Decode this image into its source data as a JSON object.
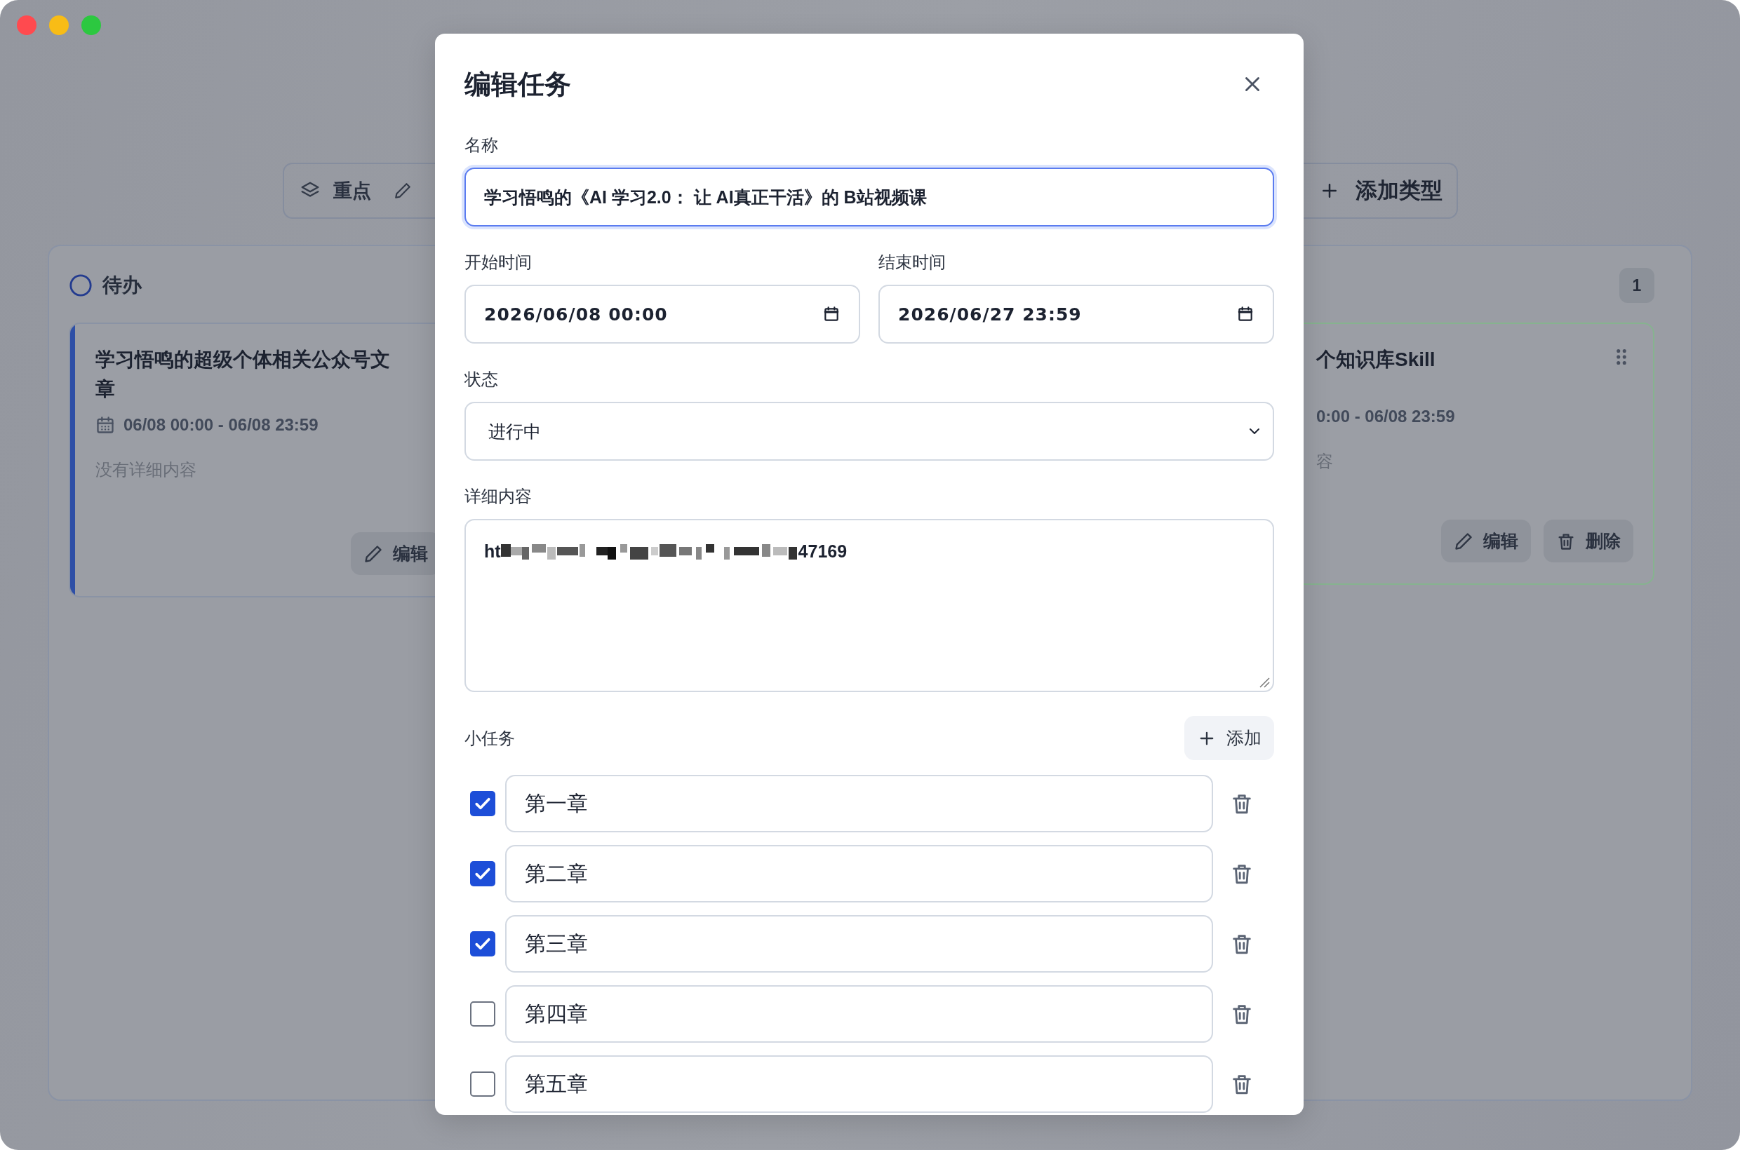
{
  "toolbar": {
    "type_chip": {
      "label": "重点"
    },
    "add_type_button": "添加类型"
  },
  "column": {
    "title": "待办",
    "count": "1",
    "cards": [
      {
        "title": "学习悟鸣的超级个体相关公众号文章",
        "date": "06/08 00:00 - 06/08 23:59",
        "description": "没有详细内容",
        "handle": false,
        "color": "#2e4fa6",
        "buttons": [
          {
            "kind": "edit",
            "label": "编辑"
          }
        ]
      },
      {
        "title": "个知识库Skill",
        "date": "0:00 - 06/08 23:59",
        "description": "容",
        "handle": true,
        "color": "#86b38f",
        "buttons": [
          {
            "kind": "edit",
            "label": "编辑"
          },
          {
            "kind": "delete",
            "label": "删除"
          }
        ]
      }
    ]
  },
  "dialog": {
    "title": "编辑任务",
    "name": {
      "label": "名称",
      "value": "学习悟鸣的《AI 学习2.0： 让 AI真正干活》的 B站视频课",
      "focused": true
    },
    "start": {
      "label": "开始时间",
      "value": "2026/06/08 00:00"
    },
    "end": {
      "label": "结束时间",
      "value": "2026/06/27 23:59"
    },
    "status": {
      "label": "状态",
      "value": "进行中"
    },
    "details": {
      "label": "详细内容",
      "text_start": "ht",
      "text_end": "47169"
    },
    "subtasks": {
      "label": "小任务",
      "add_button": "添加",
      "items": [
        {
          "title": "第一章",
          "checked": true
        },
        {
          "title": "第二章",
          "checked": true
        },
        {
          "title": "第三章",
          "checked": true
        },
        {
          "title": "第四章",
          "checked": false
        },
        {
          "title": "第五章",
          "checked": false
        }
      ]
    }
  }
}
